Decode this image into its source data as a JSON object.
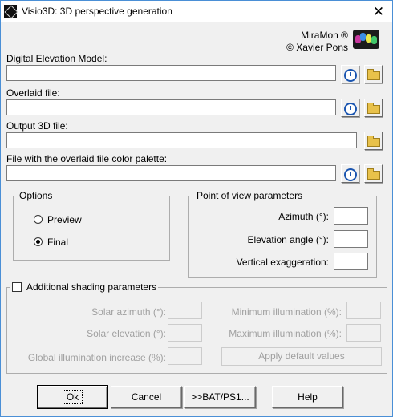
{
  "window": {
    "title": "Visio3D: 3D perspective generation",
    "close_glyph": "✕",
    "app_icon": "visio3d-icon"
  },
  "brand": {
    "name": "MiraMon ®",
    "author": "© Xavier Pons",
    "logo": "miramon-logo"
  },
  "files": {
    "dem_label": "Digital Elevation Model:",
    "overlaid_label": "Overlaid file:",
    "output_label": "Output 3D file:",
    "palette_label": "File with the overlaid file color palette:",
    "dem_value": "",
    "overlaid_value": "",
    "output_value": "",
    "palette_value": ""
  },
  "options": {
    "title": "Options",
    "preview": "Preview",
    "final": "Final",
    "selected": "Final"
  },
  "pov": {
    "title": "Point of view parameters",
    "azimuth": "Azimuth (°):",
    "elevation": "Elevation angle (°):",
    "vertical": "Vertical exaggeration:",
    "azimuth_value": "",
    "elevation_value": "",
    "vertical_value": ""
  },
  "shading": {
    "title": "Additional shading parameters",
    "checked": false,
    "solar_azimuth": "Solar azimuth (°):",
    "solar_elevation": "Solar elevation (°):",
    "global_illum": "Global illumination increase (%):",
    "min_illum": "Minimum illumination (%):",
    "max_illum": "Maximum illumination (%):",
    "apply_default": "Apply default values"
  },
  "buttons": {
    "ok": "Ok",
    "cancel": "Cancel",
    "bat": ">>BAT/PS1...",
    "help": "Help"
  },
  "colors": {
    "title_border": "#4a8fd6",
    "disabled_text": "#a0a0a0",
    "folder": "#e8c14a",
    "clock": "#1a55b0"
  }
}
